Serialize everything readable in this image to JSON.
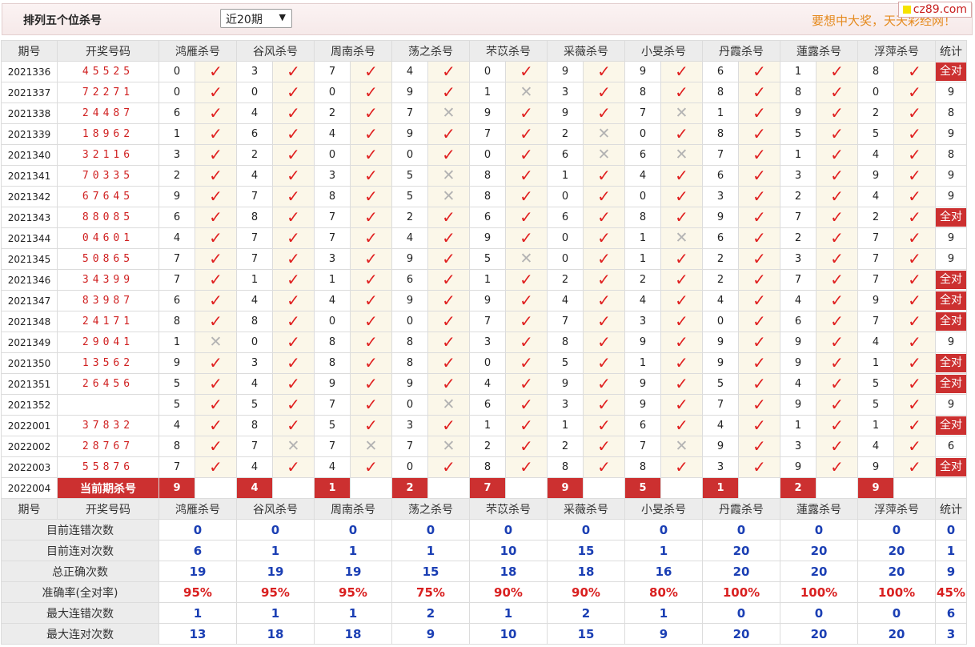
{
  "header": {
    "title": "排列五个位杀号",
    "period_select": "近20期",
    "slogan": "要想中大奖，天天彩经网！",
    "logo_text": "cz89.com"
  },
  "table": {
    "headers": [
      "期号",
      "开奖号码",
      "鸿雁杀号",
      "谷风杀号",
      "周南杀号",
      "荡之杀号",
      "芣苡杀号",
      "采薇杀号",
      "小旻杀号",
      "丹霞杀号",
      "蓮露杀号",
      "浮萍杀号",
      "统计"
    ],
    "rows": [
      {
        "issue": "2021336",
        "draw": "45525",
        "kills": [
          0,
          3,
          7,
          4,
          0,
          9,
          9,
          6,
          1,
          8
        ],
        "hits": [
          1,
          1,
          1,
          1,
          1,
          1,
          1,
          1,
          1,
          1
        ],
        "stat": "全对"
      },
      {
        "issue": "2021337",
        "draw": "72271",
        "kills": [
          0,
          0,
          0,
          9,
          1,
          3,
          8,
          8,
          8,
          0
        ],
        "hits": [
          1,
          1,
          1,
          1,
          0,
          1,
          1,
          1,
          1,
          1
        ],
        "stat": "9"
      },
      {
        "issue": "2021338",
        "draw": "24487",
        "kills": [
          6,
          4,
          2,
          7,
          9,
          9,
          7,
          1,
          9,
          2
        ],
        "hits": [
          1,
          1,
          1,
          0,
          1,
          1,
          0,
          1,
          1,
          1
        ],
        "stat": "8"
      },
      {
        "issue": "2021339",
        "draw": "18962",
        "kills": [
          1,
          6,
          4,
          9,
          7,
          2,
          0,
          8,
          5,
          5
        ],
        "hits": [
          1,
          1,
          1,
          1,
          1,
          0,
          1,
          1,
          1,
          1
        ],
        "stat": "9"
      },
      {
        "issue": "2021340",
        "draw": "32116",
        "kills": [
          3,
          2,
          0,
          0,
          0,
          6,
          6,
          7,
          1,
          4
        ],
        "hits": [
          1,
          1,
          1,
          1,
          1,
          0,
          0,
          1,
          1,
          1
        ],
        "stat": "8"
      },
      {
        "issue": "2021341",
        "draw": "70335",
        "kills": [
          2,
          4,
          3,
          5,
          8,
          1,
          4,
          6,
          3,
          9
        ],
        "hits": [
          1,
          1,
          1,
          0,
          1,
          1,
          1,
          1,
          1,
          1
        ],
        "stat": "9"
      },
      {
        "issue": "2021342",
        "draw": "67645",
        "kills": [
          9,
          7,
          8,
          5,
          8,
          0,
          0,
          3,
          2,
          4
        ],
        "hits": [
          1,
          1,
          1,
          0,
          1,
          1,
          1,
          1,
          1,
          1
        ],
        "stat": "9"
      },
      {
        "issue": "2021343",
        "draw": "88085",
        "kills": [
          6,
          8,
          7,
          2,
          6,
          6,
          8,
          9,
          7,
          2
        ],
        "hits": [
          1,
          1,
          1,
          1,
          1,
          1,
          1,
          1,
          1,
          1
        ],
        "stat": "全对"
      },
      {
        "issue": "2021344",
        "draw": "04601",
        "kills": [
          4,
          7,
          7,
          4,
          9,
          0,
          1,
          6,
          2,
          7
        ],
        "hits": [
          1,
          1,
          1,
          1,
          1,
          1,
          0,
          1,
          1,
          1
        ],
        "stat": "9"
      },
      {
        "issue": "2021345",
        "draw": "50865",
        "kills": [
          7,
          7,
          3,
          9,
          5,
          0,
          1,
          2,
          3,
          7
        ],
        "hits": [
          1,
          1,
          1,
          1,
          0,
          1,
          1,
          1,
          1,
          1
        ],
        "stat": "9"
      },
      {
        "issue": "2021346",
        "draw": "34399",
        "kills": [
          7,
          1,
          1,
          6,
          1,
          2,
          2,
          2,
          7,
          7
        ],
        "hits": [
          1,
          1,
          1,
          1,
          1,
          1,
          1,
          1,
          1,
          1
        ],
        "stat": "全对"
      },
      {
        "issue": "2021347",
        "draw": "83987",
        "kills": [
          6,
          4,
          4,
          9,
          9,
          4,
          4,
          4,
          4,
          9
        ],
        "hits": [
          1,
          1,
          1,
          1,
          1,
          1,
          1,
          1,
          1,
          1
        ],
        "stat": "全对"
      },
      {
        "issue": "2021348",
        "draw": "24171",
        "kills": [
          8,
          8,
          0,
          0,
          7,
          7,
          3,
          0,
          6,
          7
        ],
        "hits": [
          1,
          1,
          1,
          1,
          1,
          1,
          1,
          1,
          1,
          1
        ],
        "stat": "全对"
      },
      {
        "issue": "2021349",
        "draw": "29041",
        "kills": [
          1,
          0,
          8,
          8,
          3,
          8,
          9,
          9,
          9,
          4
        ],
        "hits": [
          0,
          1,
          1,
          1,
          1,
          1,
          1,
          1,
          1,
          1
        ],
        "stat": "9"
      },
      {
        "issue": "2021350",
        "draw": "13562",
        "kills": [
          9,
          3,
          8,
          8,
          0,
          5,
          1,
          9,
          9,
          1
        ],
        "hits": [
          1,
          1,
          1,
          1,
          1,
          1,
          1,
          1,
          1,
          1
        ],
        "stat": "全对"
      },
      {
        "issue": "2021351",
        "draw": "26456",
        "kills": [
          5,
          4,
          9,
          9,
          4,
          9,
          9,
          5,
          4,
          5
        ],
        "hits": [
          1,
          1,
          1,
          1,
          1,
          1,
          1,
          1,
          1,
          1
        ],
        "stat": "全对"
      },
      {
        "issue": "2021352",
        "draw": "",
        "kills": [
          5,
          5,
          7,
          0,
          6,
          3,
          9,
          7,
          9,
          5
        ],
        "hits": [
          1,
          1,
          1,
          0,
          1,
          1,
          1,
          1,
          1,
          1
        ],
        "stat": "9"
      },
      {
        "issue": "2022001",
        "draw": "37832",
        "kills": [
          4,
          8,
          5,
          3,
          1,
          1,
          6,
          4,
          1,
          1
        ],
        "hits": [
          1,
          1,
          1,
          1,
          1,
          1,
          1,
          1,
          1,
          1
        ],
        "stat": "全对"
      },
      {
        "issue": "2022002",
        "draw": "28767",
        "kills": [
          8,
          7,
          7,
          7,
          2,
          2,
          7,
          9,
          3,
          4
        ],
        "hits": [
          1,
          0,
          0,
          0,
          1,
          1,
          0,
          1,
          1,
          1
        ],
        "stat": "6"
      },
      {
        "issue": "2022003",
        "draw": "55876",
        "kills": [
          7,
          4,
          4,
          0,
          8,
          8,
          8,
          3,
          9,
          9
        ],
        "hits": [
          1,
          1,
          1,
          1,
          1,
          1,
          1,
          1,
          1,
          1
        ],
        "stat": "全对"
      }
    ],
    "current": {
      "issue": "2022004",
      "label": "当前期杀号",
      "kills": [
        9,
        4,
        1,
        2,
        7,
        9,
        5,
        1,
        2,
        9
      ]
    },
    "summary": [
      {
        "label": "目前连错次数",
        "values": [
          0,
          0,
          0,
          0,
          0,
          0,
          0,
          0,
          0,
          0
        ],
        "stat": "0"
      },
      {
        "label": "目前连对次数",
        "values": [
          6,
          1,
          1,
          1,
          10,
          15,
          1,
          20,
          20,
          20
        ],
        "stat": "1"
      },
      {
        "label": "总正确次数",
        "values": [
          19,
          19,
          19,
          15,
          18,
          18,
          16,
          20,
          20,
          20
        ],
        "stat": "9"
      },
      {
        "label": "准确率(全对率)",
        "values": [
          "95%",
          "95%",
          "95%",
          "75%",
          "90%",
          "90%",
          "80%",
          "100%",
          "100%",
          "100%"
        ],
        "stat": "45%"
      },
      {
        "label": "最大连错次数",
        "values": [
          1,
          1,
          1,
          2,
          1,
          2,
          1,
          0,
          0,
          0
        ],
        "stat": "6"
      },
      {
        "label": "最大连对次数",
        "values": [
          13,
          18,
          18,
          9,
          10,
          15,
          9,
          20,
          20,
          20
        ],
        "stat": "3"
      }
    ]
  },
  "icons": {
    "hit": "check-icon",
    "miss": "cross-icon"
  },
  "colors": {
    "accent": "#cc3030",
    "check": "#e02020",
    "summary_value": "#1b3fb4",
    "slogan": "#e58a1e"
  }
}
